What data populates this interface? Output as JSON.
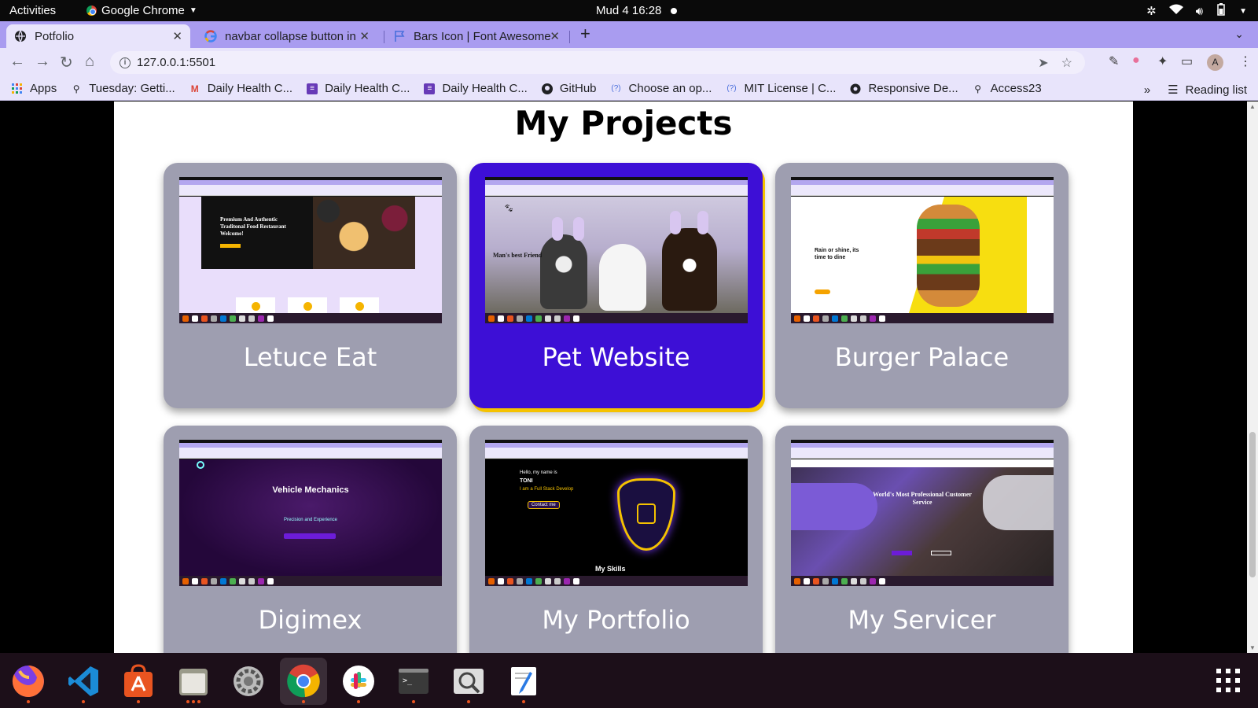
{
  "system": {
    "activities": "Activities",
    "app_name": "Google Chrome",
    "clock": "Mud 4  16:28"
  },
  "tabs": [
    {
      "title": "Potfolio",
      "icon": "portfolio-favicon"
    },
    {
      "title": "navbar collapse button in",
      "icon": "google-icon"
    },
    {
      "title": "Bars Icon | Font Awesome",
      "icon": "flag-icon"
    }
  ],
  "toolbar": {
    "url": "127.0.0.1:5501"
  },
  "bookmarks": [
    {
      "label": "Apps",
      "icon": "apps-grid-icon"
    },
    {
      "label": "Tuesday: Getti...",
      "icon": "pin-icon"
    },
    {
      "label": "Daily Health C...",
      "icon": "gmail-icon"
    },
    {
      "label": "Daily Health C...",
      "icon": "form-icon"
    },
    {
      "label": "Daily Health C...",
      "icon": "form-icon"
    },
    {
      "label": "GitHub",
      "icon": "github-icon"
    },
    {
      "label": "Choose an op...",
      "icon": "question-icon"
    },
    {
      "label": "MIT License | C...",
      "icon": "question-icon"
    },
    {
      "label": "Responsive De...",
      "icon": "globe-icon"
    },
    {
      "label": "Access23",
      "icon": "pin-icon"
    }
  ],
  "bookmarks_right": {
    "overflow": "»",
    "reading_list": "Reading list"
  },
  "page": {
    "section_title": "My Projects",
    "projects": [
      {
        "label": "Letuce Eat",
        "highlighted": false
      },
      {
        "label": "Pet Website",
        "highlighted": true
      },
      {
        "label": "Burger Palace",
        "highlighted": false
      },
      {
        "label": "Digimex",
        "highlighted": false
      },
      {
        "label": "My Portfolio",
        "highlighted": false
      },
      {
        "label": "My Servicer",
        "highlighted": false
      }
    ],
    "thumbnail_text": {
      "letuce": "Premium And Authentic Traditonal Food Restaurant Welcome!",
      "pet": "Man's best Friend",
      "burger": "Rain or shine, its time to dine",
      "digimex_title": "Vehicle Mechanics",
      "digimex_sub": "Precision and Experience",
      "portfolio_hello": "Hello, my name is",
      "portfolio_name": "TONI",
      "portfolio_role": "I am a Full Stack Develop",
      "portfolio_cta": "Contact me",
      "portfolio_skills": "My Skills",
      "servicer": "World's Most Professional Customer Service"
    }
  },
  "colors": {
    "card_bg": "#9e9eb0",
    "card_highlight": "#3d0fd6",
    "highlight_shadow": "#f5c200",
    "tabstrip": "#a99cf0"
  },
  "dock": [
    {
      "name": "firefox",
      "dots": 1
    },
    {
      "name": "vscode",
      "dots": 1
    },
    {
      "name": "software-center",
      "dots": 1
    },
    {
      "name": "files",
      "dots": 3
    },
    {
      "name": "settings",
      "dots": 0
    },
    {
      "name": "chrome",
      "dots": 1
    },
    {
      "name": "slack",
      "dots": 1
    },
    {
      "name": "terminal",
      "dots": 1
    },
    {
      "name": "image-viewer",
      "dots": 1
    },
    {
      "name": "text-editor",
      "dots": 1
    }
  ]
}
